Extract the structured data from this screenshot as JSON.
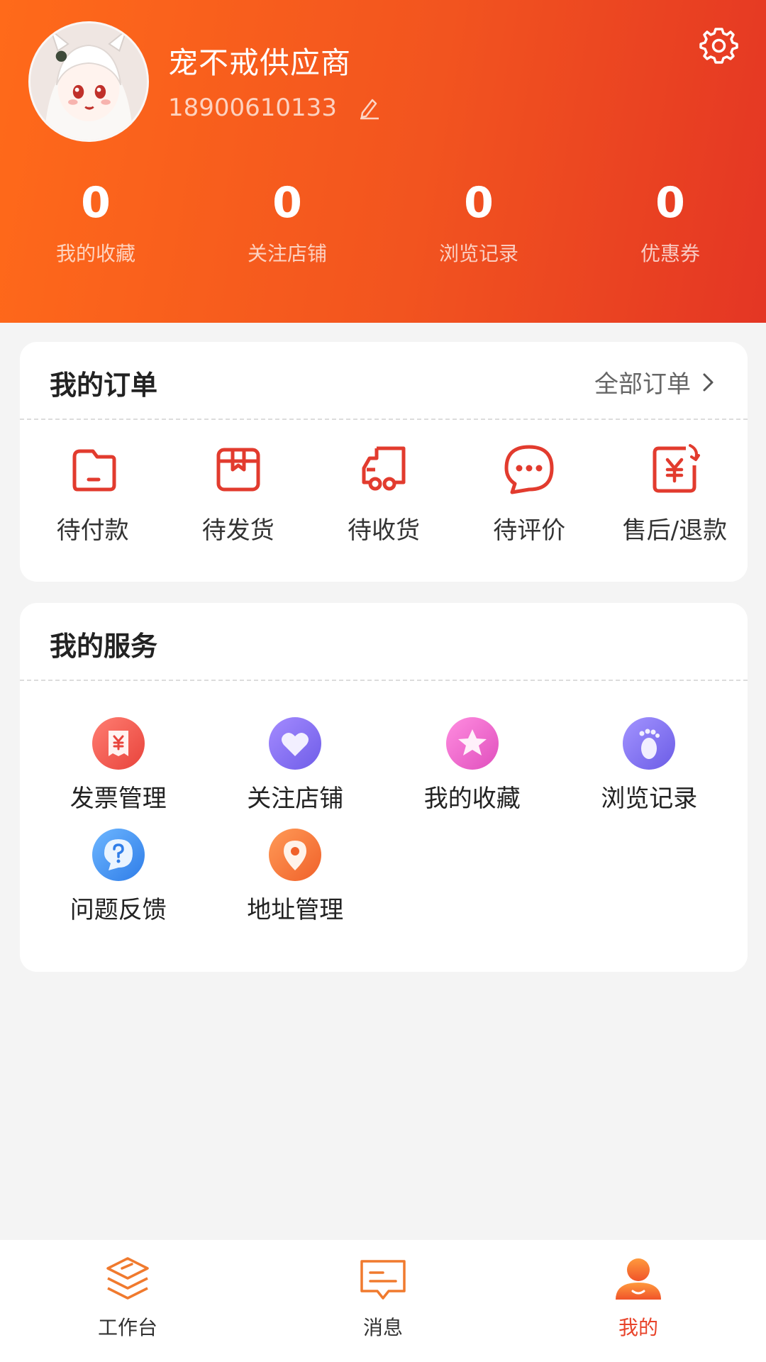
{
  "profile": {
    "shop_name": "宠不戒供应商",
    "phone": "18900610133"
  },
  "stats": [
    {
      "value": "0",
      "label": "我的收藏"
    },
    {
      "value": "0",
      "label": "关注店铺"
    },
    {
      "value": "0",
      "label": "浏览记录"
    },
    {
      "value": "0",
      "label": "优惠券"
    }
  ],
  "orders": {
    "title": "我的订单",
    "all_link": "全部订单",
    "items": [
      {
        "label": "待付款",
        "icon": "wallet-icon"
      },
      {
        "label": "待发货",
        "icon": "box-icon"
      },
      {
        "label": "待收货",
        "icon": "truck-icon"
      },
      {
        "label": "待评价",
        "icon": "chat-bubble-icon"
      },
      {
        "label": "售后/退款",
        "icon": "refund-icon"
      }
    ]
  },
  "services": {
    "title": "我的服务",
    "items": [
      {
        "label": "发票管理",
        "icon": "invoice-icon"
      },
      {
        "label": "关注店铺",
        "icon": "heart-icon"
      },
      {
        "label": "我的收藏",
        "icon": "star-icon"
      },
      {
        "label": "浏览记录",
        "icon": "footprint-icon"
      },
      {
        "label": "问题反馈",
        "icon": "question-icon"
      },
      {
        "label": "地址管理",
        "icon": "location-pin-icon"
      }
    ]
  },
  "tabbar": {
    "items": [
      {
        "label": "工作台",
        "icon": "workbench-icon",
        "active": false
      },
      {
        "label": "消息",
        "icon": "message-icon",
        "active": false
      },
      {
        "label": "我的",
        "icon": "user-icon",
        "active": true
      }
    ]
  },
  "colors": {
    "header_start": "#ff6a1a",
    "header_end": "#e43624",
    "accent": "#e8432a",
    "order_icon": "#e23b2e"
  }
}
